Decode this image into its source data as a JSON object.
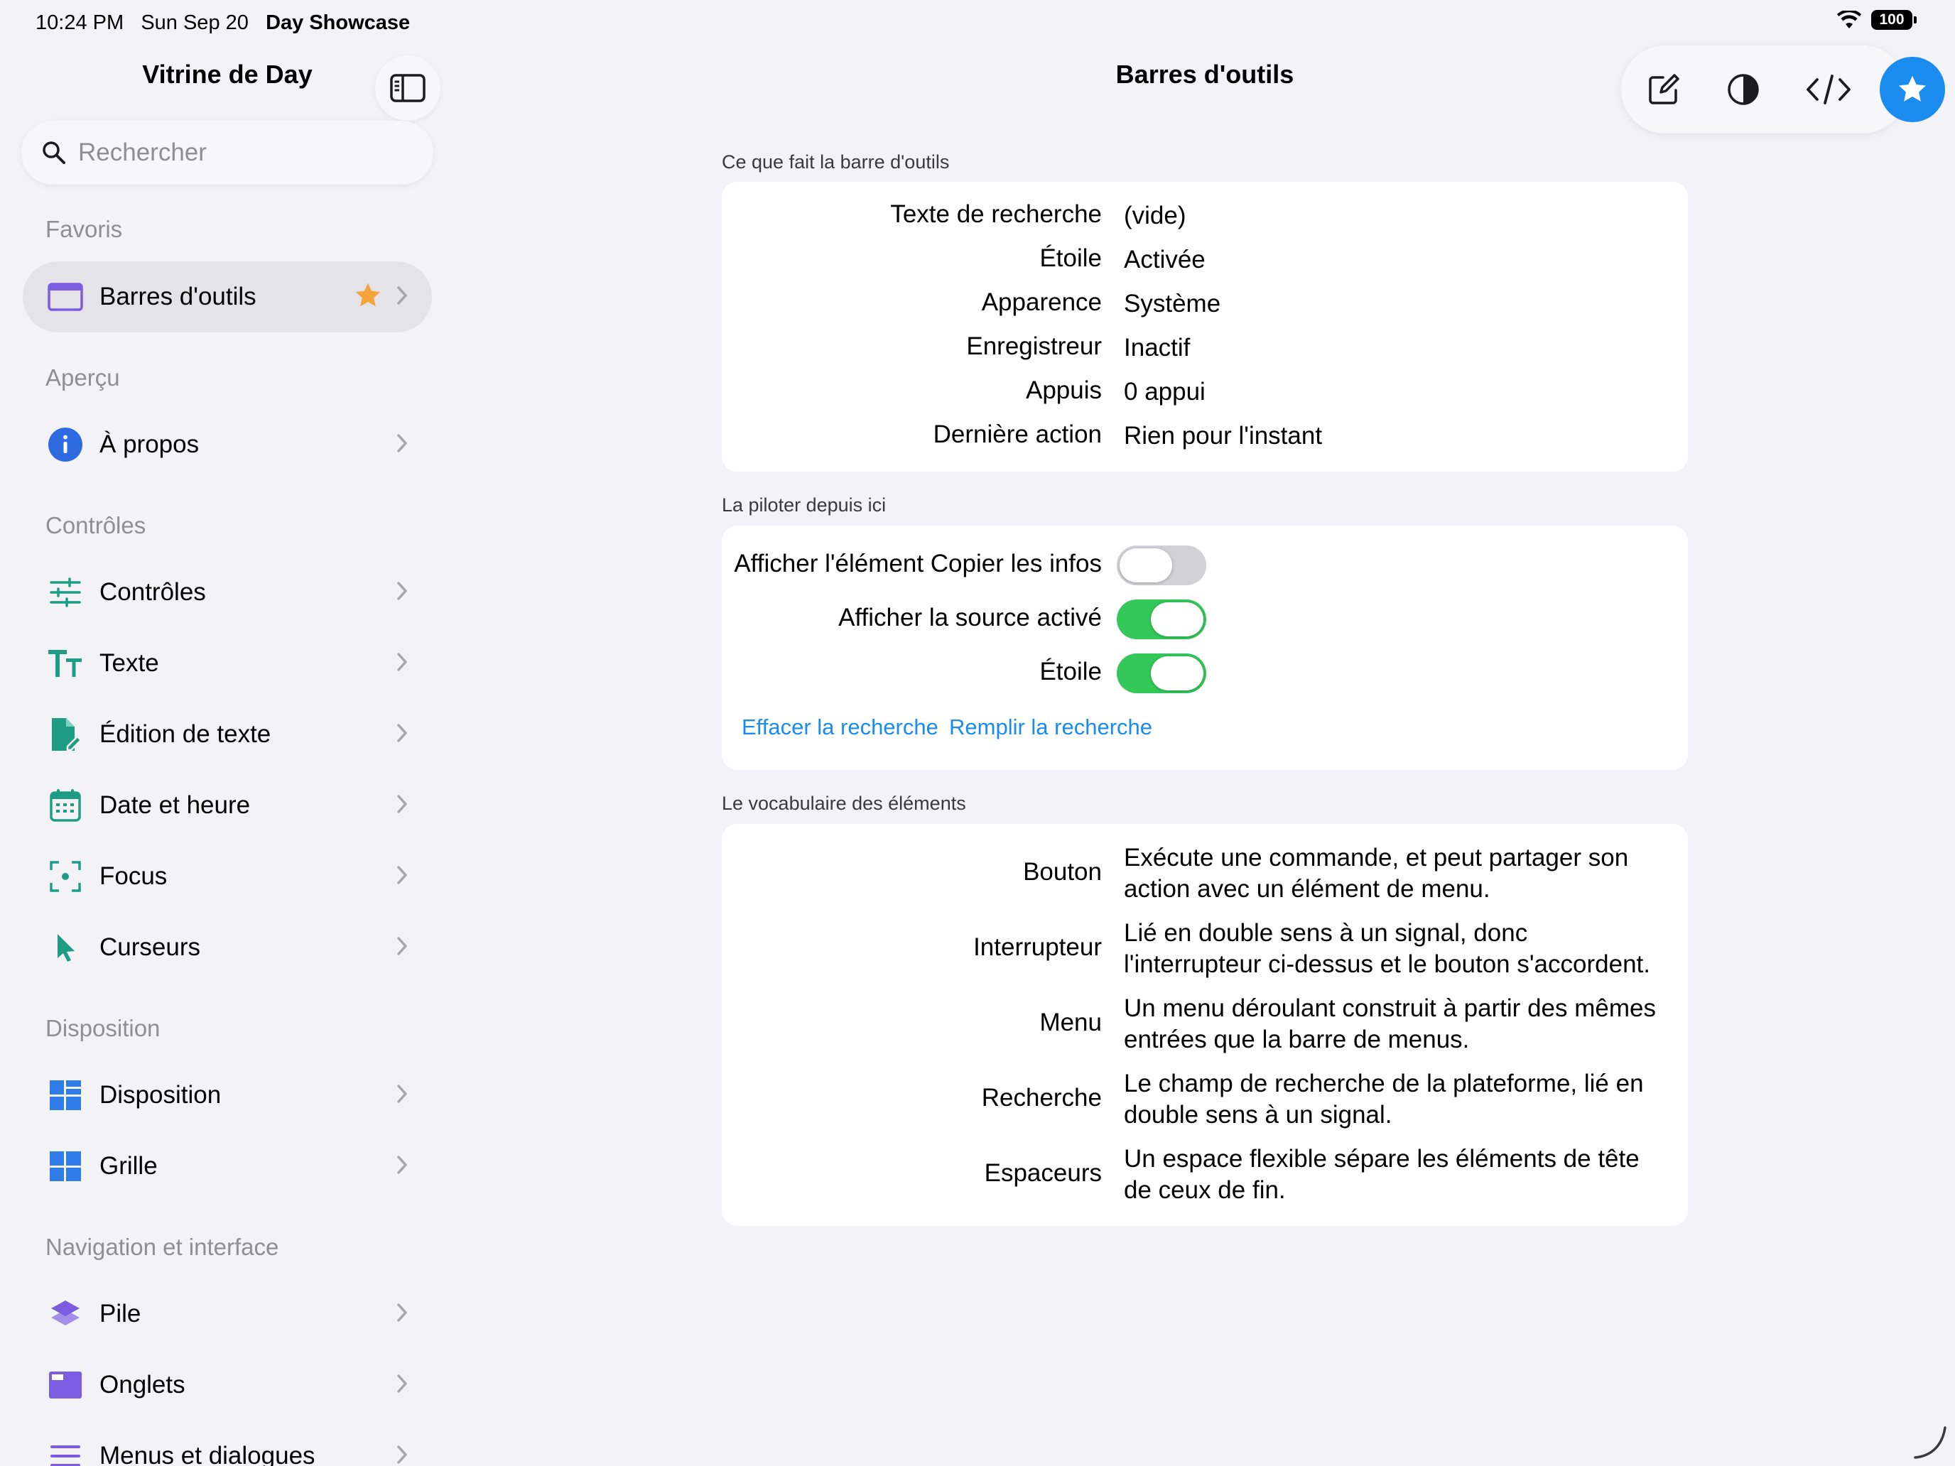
{
  "status": {
    "time": "10:24 PM",
    "date": "Sun Sep 20",
    "app": "Day Showcase",
    "battery": "100"
  },
  "sidebar": {
    "title": "Vitrine de Day",
    "search_placeholder": "Rechercher",
    "sections": [
      {
        "header": "Favoris",
        "items": [
          {
            "label": "Barres d'outils",
            "icon": "window-icon",
            "color": "#7c5ce0",
            "favorite": true,
            "selected": true
          }
        ]
      },
      {
        "header": "Aperçu",
        "items": [
          {
            "label": "À propos",
            "icon": "info-icon",
            "color": "#2f6be0"
          }
        ]
      },
      {
        "header": "Contrôles",
        "items": [
          {
            "label": "Contrôles",
            "icon": "sliders-icon",
            "color": "#1f9d84"
          },
          {
            "label": "Texte",
            "icon": "text-size-icon",
            "color": "#1f9d84"
          },
          {
            "label": "Édition de texte",
            "icon": "document-edit-icon",
            "color": "#1f9d84"
          },
          {
            "label": "Date et heure",
            "icon": "calendar-icon",
            "color": "#1f9d84"
          },
          {
            "label": "Focus",
            "icon": "focus-icon",
            "color": "#1f9d84"
          },
          {
            "label": "Curseurs",
            "icon": "pointer-icon",
            "color": "#1f9d84"
          }
        ]
      },
      {
        "header": "Disposition",
        "items": [
          {
            "label": "Disposition",
            "icon": "layout-icon",
            "color": "#2f7be8"
          },
          {
            "label": "Grille",
            "icon": "grid-icon",
            "color": "#2f7be8"
          }
        ]
      },
      {
        "header": "Navigation et interface",
        "items": [
          {
            "label": "Pile",
            "icon": "stack-icon",
            "color": "#7c5ce0"
          },
          {
            "label": "Onglets",
            "icon": "tabs-icon",
            "color": "#7c5ce0"
          },
          {
            "label": "Menus et dialogues",
            "icon": "menu-icon",
            "color": "#7c5ce0"
          }
        ]
      }
    ]
  },
  "detail": {
    "title": "Barres d'outils",
    "toolbar": {
      "buttons": [
        "compose-icon",
        "appearance-icon",
        "code-icon",
        "star-icon"
      ]
    },
    "groups": [
      {
        "header": "Ce que fait la barre d'outils",
        "rows": [
          {
            "key": "Texte de recherche",
            "value": "(vide)"
          },
          {
            "key": "Étoile",
            "value": "Activée"
          },
          {
            "key": "Apparence",
            "value": "Système"
          },
          {
            "key": "Enregistreur",
            "value": "Inactif"
          },
          {
            "key": "Appuis",
            "value": "0 appui"
          },
          {
            "key": "Dernière action",
            "value": "Rien pour l'instant"
          }
        ]
      },
      {
        "header": "La piloter depuis ici",
        "toggles": [
          {
            "label": "Afficher l'élément Copier les infos",
            "on": false
          },
          {
            "label": "Afficher la source activé",
            "on": true
          },
          {
            "label": "Étoile",
            "on": true
          }
        ],
        "links": [
          "Effacer la recherche",
          "Remplir la recherche"
        ]
      },
      {
        "header": "Le vocabulaire des éléments",
        "rows": [
          {
            "key": "Bouton",
            "value": "Exécute une commande, et peut partager son action avec un élément de menu."
          },
          {
            "key": "Interrupteur",
            "value": "Lié en double sens à un signal, donc l'interrupteur ci-dessus et le bouton s'accordent."
          },
          {
            "key": "Menu",
            "value": "Un menu déroulant construit à partir des mêmes entrées que la barre de menus."
          },
          {
            "key": "Recherche",
            "value": "Le champ de recherche de la plateforme, lié en double sens à un signal."
          },
          {
            "key": "Espaceurs",
            "value": "Un espace flexible sépare les éléments de tête de ceux de fin."
          }
        ]
      }
    ]
  },
  "colors": {
    "accent": "#1a8cf0",
    "toggle_on": "#34c759",
    "favorite_star": "#f5a33b"
  }
}
